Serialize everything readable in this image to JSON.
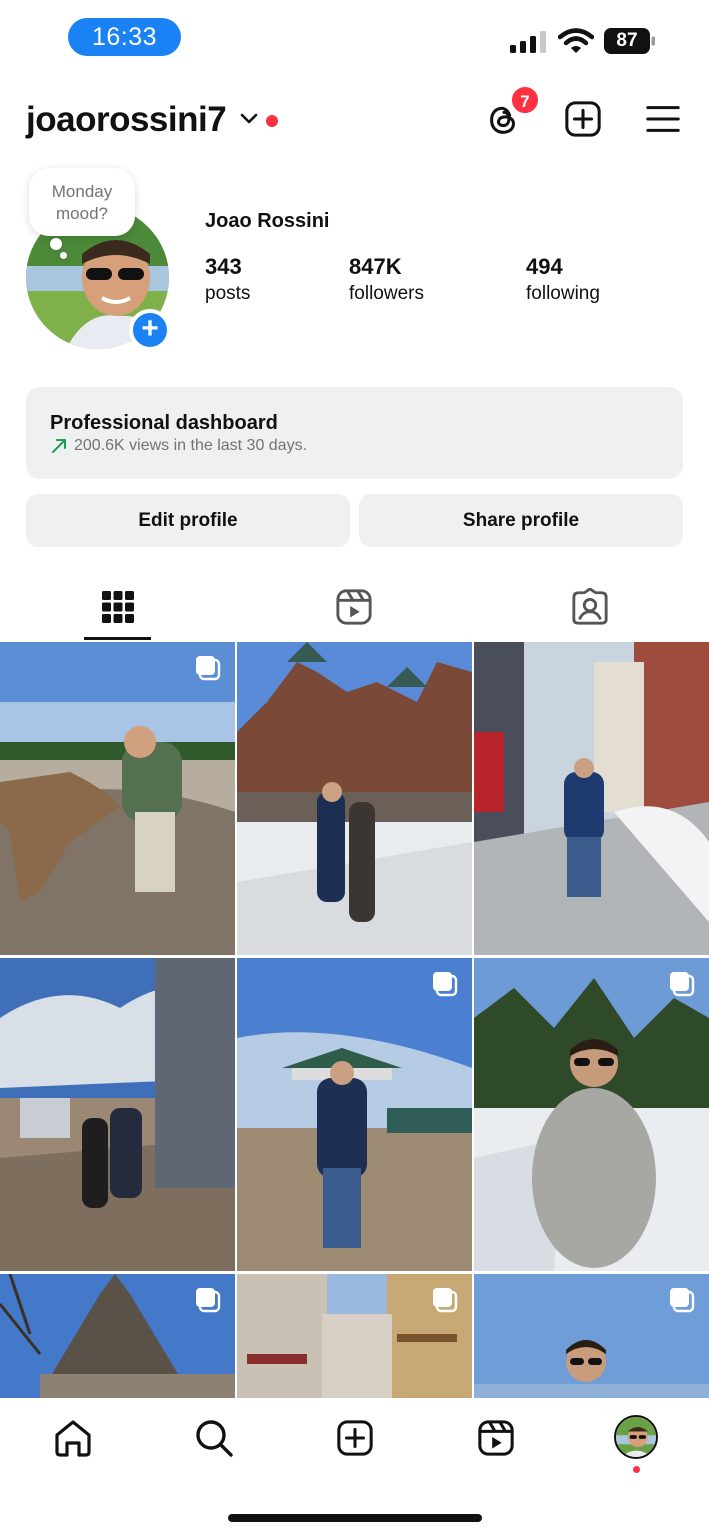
{
  "status_bar": {
    "time": "16:33",
    "battery": "87"
  },
  "header": {
    "username": "joaorossini7",
    "threads_badge": "7"
  },
  "profile": {
    "note": "Monday mood?",
    "display_name": "Joao Rossini",
    "stats": [
      {
        "value": "343",
        "label": "posts"
      },
      {
        "value": "847K",
        "label": "followers"
      },
      {
        "value": "494",
        "label": "following"
      }
    ]
  },
  "dashboard": {
    "title": "Professional dashboard",
    "subtitle": "200.6K views in the last 30 days."
  },
  "buttons": {
    "edit": "Edit profile",
    "share": "Share profile"
  },
  "tabs": [
    "grid-icon",
    "reels-icon",
    "tagged-icon"
  ],
  "grid_icons": [
    "home-icon",
    "search-icon",
    "create-icon",
    "reels-icon",
    "profile-avatar"
  ],
  "colors": {
    "accent_blue": "#1a82f5",
    "notification_red": "#ff3040",
    "surface": "#eff0f2",
    "trend_green": "#1d9e55"
  }
}
